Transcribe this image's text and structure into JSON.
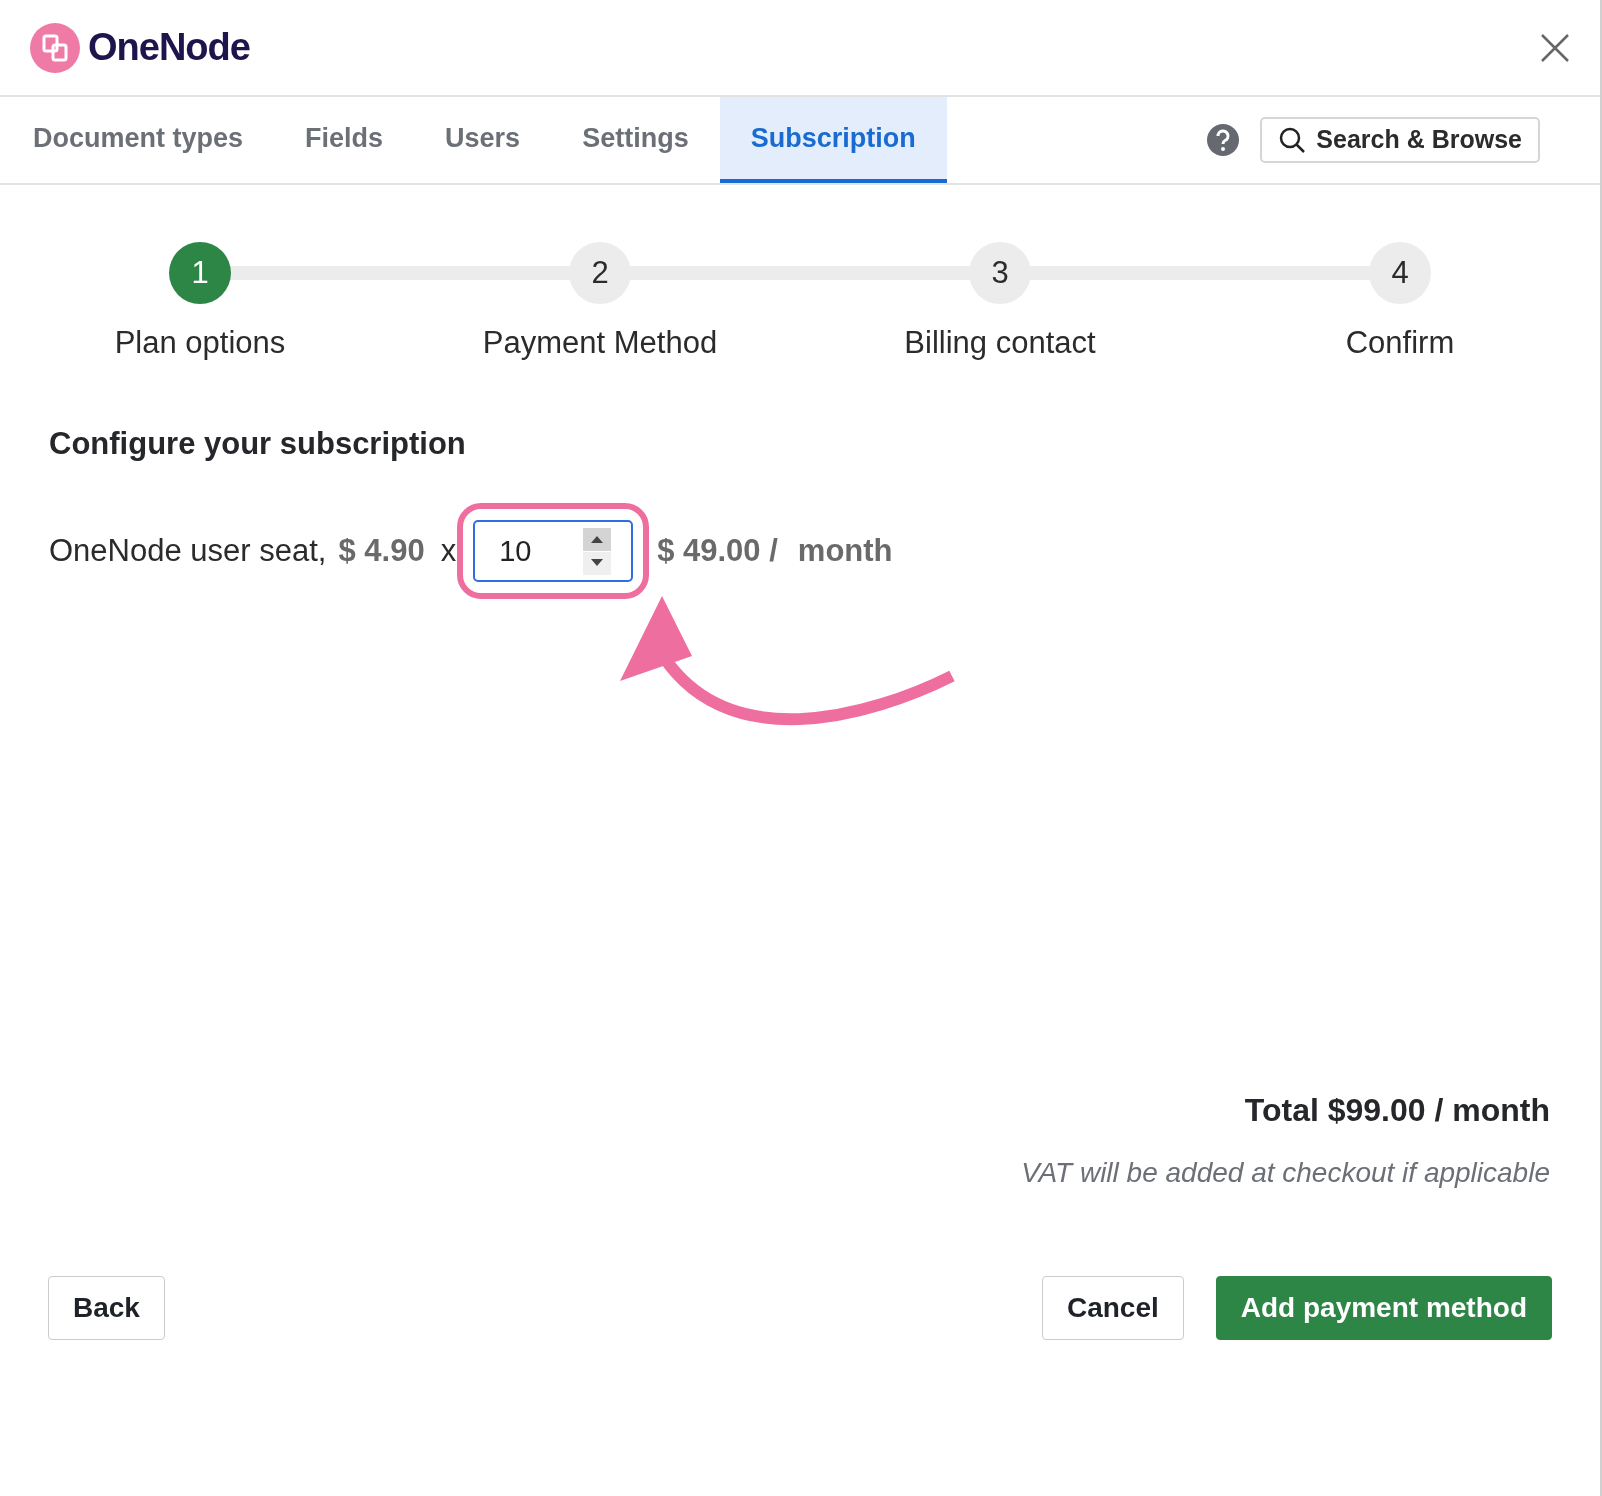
{
  "header": {
    "logo_text": "OneNode"
  },
  "tabs": [
    {
      "label": "Document types",
      "selected": false
    },
    {
      "label": "Fields",
      "selected": false
    },
    {
      "label": "Users",
      "selected": false
    },
    {
      "label": "Settings",
      "selected": false
    },
    {
      "label": "Subscription",
      "selected": true
    }
  ],
  "search_button": {
    "label": "Search & Browse"
  },
  "steps": [
    {
      "number": "1",
      "label": "Plan options",
      "selected": true
    },
    {
      "number": "2",
      "label": "Payment Method",
      "selected": false
    },
    {
      "number": "3",
      "label": "Billing contact",
      "selected": false
    },
    {
      "number": "4",
      "label": "Confirm",
      "selected": false
    }
  ],
  "section": {
    "title": "Configure your subscription"
  },
  "seat_line": {
    "label": "OneNode user seat,",
    "price": "$ 4.90",
    "times": "x",
    "quantity": "10",
    "subtotal": "$ 49.00 /",
    "period": "month"
  },
  "summary": {
    "total": "Total $99.00 / month",
    "note": "VAT will be added at checkout if applicable"
  },
  "buttons": [
    {
      "label": "Back",
      "kind": "secondary"
    },
    {
      "label": "Cancel",
      "kind": "secondary"
    },
    {
      "label": "Add payment method",
      "kind": "primary"
    }
  ]
}
